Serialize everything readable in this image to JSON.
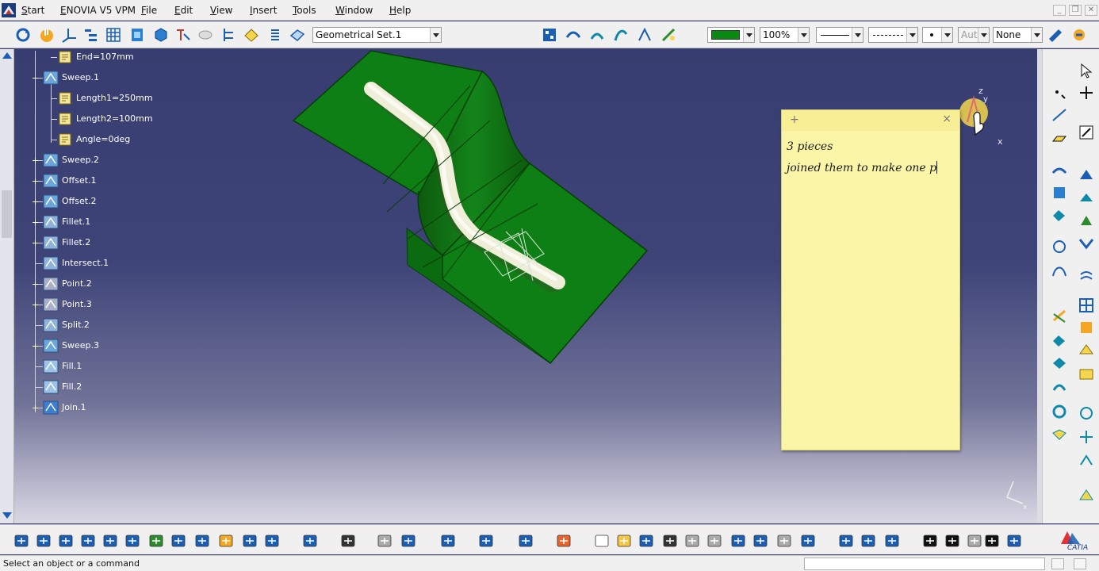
{
  "menubar": {
    "start": "Start",
    "enovia": "ENOVIA V5 VPM",
    "file": "File",
    "edit": "Edit",
    "view": "View",
    "insert": "Insert",
    "tools": "Tools",
    "window": "Window",
    "help": "Help"
  },
  "toolbar": {
    "geometrical_set": "Geometrical Set.1",
    "color_swatch": "#0a8a12",
    "transparency": "100%",
    "layer": "None",
    "auto": "Aut"
  },
  "tree": [
    {
      "label": "End=107mm",
      "icon": "parameter-icon"
    },
    {
      "label": "Sweep.1",
      "icon": "sweep-icon"
    },
    {
      "label": "Length1=250mm",
      "icon": "parameter-icon"
    },
    {
      "label": "Length2=100mm",
      "icon": "parameter-icon"
    },
    {
      "label": "Angle=0deg",
      "icon": "parameter-icon"
    },
    {
      "label": "Sweep.2",
      "icon": "sweep-icon"
    },
    {
      "label": "Offset.1",
      "icon": "offset-icon"
    },
    {
      "label": "Offset.2",
      "icon": "offset-icon"
    },
    {
      "label": "Fillet.1",
      "icon": "fillet-icon"
    },
    {
      "label": "Fillet.2",
      "icon": "fillet-icon"
    },
    {
      "label": "Intersect.1",
      "icon": "intersect-icon"
    },
    {
      "label": "Point.2",
      "icon": "point-icon"
    },
    {
      "label": "Point.3",
      "icon": "point-icon"
    },
    {
      "label": "Split.2",
      "icon": "split-icon"
    },
    {
      "label": "Sweep.3",
      "icon": "sweep-icon"
    },
    {
      "label": "Fill.1",
      "icon": "fill-icon"
    },
    {
      "label": "Fill.2",
      "icon": "fill-icon"
    },
    {
      "label": "Join.1",
      "icon": "join-icon"
    }
  ],
  "note": {
    "line1": "3 pieces",
    "line2": "joined them to make one p"
  },
  "status": {
    "message": "Select an object or a command"
  },
  "brand": {
    "catia": "CATIA"
  }
}
